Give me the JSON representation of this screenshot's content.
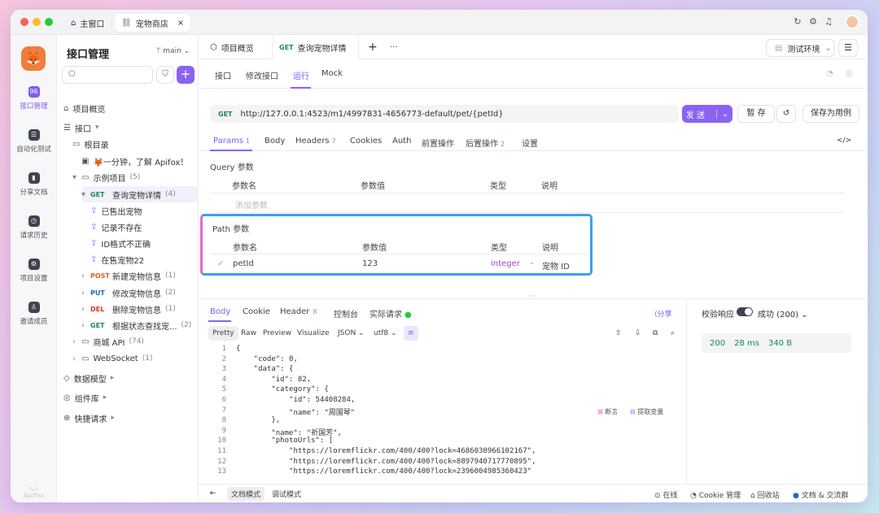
{
  "titlebar": {
    "home_tab": "主窗口",
    "store_tab": "宠物商店",
    "close": "×"
  },
  "rail": {
    "items": [
      {
        "label": "接口管理",
        "icon": "api-icon"
      },
      {
        "label": "自动化测试",
        "icon": "automation-icon"
      },
      {
        "label": "分享文档",
        "icon": "book-icon"
      },
      {
        "label": "请求历史",
        "icon": "clock-icon"
      },
      {
        "label": "项目设置",
        "icon": "gear-icon"
      },
      {
        "label": "邀请成员",
        "icon": "add-user-icon"
      }
    ],
    "brand": "Apifox"
  },
  "sidebar": {
    "title": "接口管理",
    "branch": "main",
    "tree": [
      {
        "label": "项目概览",
        "indent": 0,
        "icon": "⌂"
      },
      {
        "label": "接口",
        "indent": 0,
        "icon": "☰",
        "suffix": "▾"
      },
      {
        "label": "根目录",
        "indent": 1,
        "icon": "▭"
      },
      {
        "label": "🦊一分钟，了解 Apifox！",
        "indent": 2,
        "icon": "▣"
      },
      {
        "label": "示例项目",
        "indent": 1,
        "icon": "▭",
        "count": "(5)",
        "arrow": "▾"
      },
      {
        "label": "查询宠物详情",
        "indent": 2,
        "method": "GET",
        "count": "(4)",
        "arrow": "▾",
        "selected": true
      },
      {
        "label": "已售出宠物",
        "indent": 3,
        "icon": "⇪"
      },
      {
        "label": "记录不存在",
        "indent": 3,
        "icon": "⇪"
      },
      {
        "label": "ID格式不正确",
        "indent": 3,
        "icon": "⇪"
      },
      {
        "label": "在售宠物22",
        "indent": 3,
        "icon": "⇪"
      },
      {
        "label": "新建宠物信息",
        "indent": 2,
        "method": "POST",
        "count": "(1)",
        "arrow": "›"
      },
      {
        "label": "修改宠物信息",
        "indent": 2,
        "method": "PUT",
        "count": "(2)",
        "arrow": "›"
      },
      {
        "label": "删除宠物信息",
        "indent": 2,
        "method": "DEL",
        "count": "(1)",
        "arrow": "›"
      },
      {
        "label": "根据状态查找宠...",
        "indent": 2,
        "method": "GET",
        "count": "(2)",
        "arrow": "›"
      },
      {
        "label": "商城 API",
        "indent": 1,
        "icon": "▭",
        "count": "(74)",
        "arrow": "›"
      },
      {
        "label": "WebSocket",
        "indent": 1,
        "icon": "▭",
        "count": "(1)",
        "arrow": "›"
      },
      {
        "label": "数据模型",
        "indent": 0,
        "icon": "◇",
        "suffix": "▸"
      },
      {
        "label": "组件库",
        "indent": 0,
        "icon": "◎",
        "suffix": "▸"
      },
      {
        "label": "快捷请求",
        "indent": 0,
        "icon": "⊕",
        "suffix": "▸"
      }
    ]
  },
  "colors": {
    "accent": "#8a63f2",
    "get": "#1a8a4e",
    "post": "#d9622b",
    "put": "#2a63c8",
    "del": "#d9342b"
  },
  "tabs": {
    "overview": "项目概览",
    "current_method": "GET",
    "current": "查询宠物详情",
    "add": "+",
    "more": "···",
    "env": "测试环境"
  },
  "subtabs": [
    "接口",
    "修改接口",
    "运行",
    "Mock"
  ],
  "request": {
    "method": "GET",
    "url": "http://127.0.0.1:4523/m1/4997831-4656773-default/pet/{petId}",
    "send": "发 送",
    "save_draft": "暂 存",
    "save_case": "保存为用例"
  },
  "param_tabs": [
    {
      "label": "Params",
      "badge": "1"
    },
    {
      "label": "Body"
    },
    {
      "label": "Headers",
      "badge": "7"
    },
    {
      "label": "Cookies"
    },
    {
      "label": "Auth"
    },
    {
      "label": "前置操作"
    },
    {
      "label": "后置操作",
      "badge": "2"
    },
    {
      "label": "设置"
    }
  ],
  "query": {
    "title": "Query 参数",
    "cols": [
      "参数名",
      "参数值",
      "类型",
      "说明"
    ],
    "placeholder": "添加参数"
  },
  "path": {
    "title": "Path 参数",
    "cols": [
      "参数名",
      "参数值",
      "类型",
      "说明"
    ],
    "row": {
      "name": "petId",
      "value": "123",
      "type": "integer",
      "desc": "宠物 ID"
    }
  },
  "response": {
    "tabs": [
      {
        "label": "Body"
      },
      {
        "label": "Cookie"
      },
      {
        "label": "Header",
        "badge": "8"
      },
      {
        "label": "控制台"
      },
      {
        "label": "实际请求"
      }
    ],
    "share": "分享",
    "formats": [
      "Pretty",
      "Raw",
      "Preview",
      "Visualize"
    ],
    "json": "JSON",
    "enc": "utf8",
    "assert": "断言",
    "extract": "提取变量",
    "lines": [
      {
        "n": "1",
        "t": "{"
      },
      {
        "n": "2",
        "t": "    \"code\": 0,"
      },
      {
        "n": "3",
        "t": "    \"data\": {"
      },
      {
        "n": "4",
        "t": "        \"id\": 82,"
      },
      {
        "n": "5",
        "t": "        \"category\": {"
      },
      {
        "n": "6",
        "t": "            \"id\": 54408284,"
      },
      {
        "n": "7",
        "t": "            \"name\": \"周国琴\""
      },
      {
        "n": "8",
        "t": "        },"
      },
      {
        "n": "9",
        "t": "        \"name\": \"祈国芳\","
      },
      {
        "n": "10",
        "t": "        \"photoUrls\": ["
      },
      {
        "n": "11",
        "t": "            \"https://loremflickr.com/400/400?lock=4686030966102167\","
      },
      {
        "n": "12",
        "t": "            \"https://loremflickr.com/400/400?lock=8897940717770895\","
      },
      {
        "n": "13",
        "t": "            \"https://loremflickr.com/400/400?lock=2396004985360423\""
      }
    ]
  },
  "validate": {
    "label": "校验响应",
    "result": "成功 (200)",
    "status": "200",
    "time": "28 ms",
    "size": "340 B"
  },
  "statusbar": {
    "doc_mode": "文档模式",
    "debug_mode": "调试模式",
    "online": "在线",
    "cookie": "Cookie 管理",
    "trash": "回收站",
    "docs": "文档 & 交流群"
  }
}
